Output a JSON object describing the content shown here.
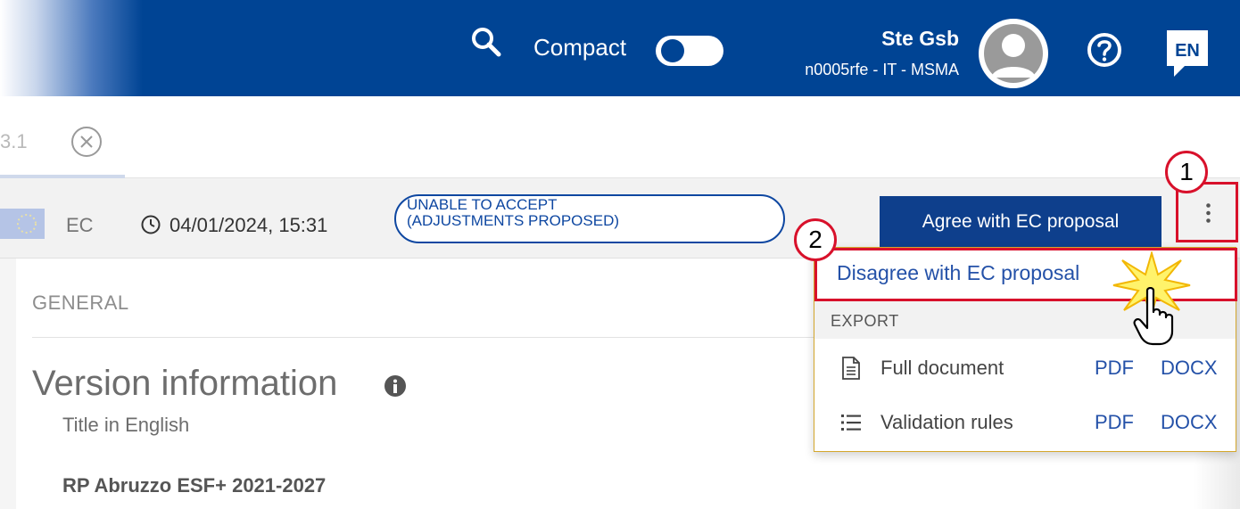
{
  "header": {
    "search_icon": "search-icon",
    "compact_label": "Compact",
    "compact_on": false,
    "user_name": "Ste Gsb",
    "user_org": "n0005rfe - IT - MSMA",
    "help_icon": "question-circle-icon",
    "language": "EN",
    "brand_color": "#004494"
  },
  "tab": {
    "label": "3.1",
    "close_icon": "close-circle-icon"
  },
  "status_bar": {
    "owner": "EC",
    "datetime": "04/01/2024, 15:31",
    "status": "UNABLE TO ACCEPT\n(ADJUSTMENTS PROPOSED)",
    "agree_button": "Agree with EC proposal",
    "more_icon": "kebab-menu-icon"
  },
  "dropdown": {
    "disagree": "Disagree with EC proposal",
    "export_header": "EXPORT",
    "rows": [
      {
        "label": "Full document",
        "pdf": "PDF",
        "docx": "DOCX",
        "icon": "document-icon"
      },
      {
        "label": "Validation rules",
        "pdf": "PDF",
        "docx": "DOCX",
        "icon": "list-icon"
      }
    ]
  },
  "main": {
    "section": "GENERAL",
    "title": "Version information",
    "info_icon": "info-icon",
    "field_label": "Title in English",
    "field_value": "RP Abruzzo ESF+ 2021-2027"
  },
  "callouts": [
    "1",
    "2"
  ],
  "highlight_color": "#d8112b"
}
